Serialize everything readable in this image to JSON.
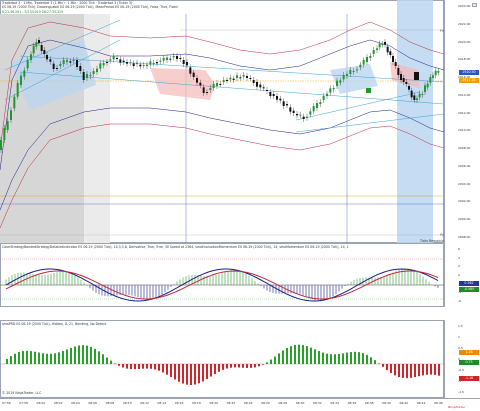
{
  "chart_window": {
    "header": "Traderbot 3 · 1 Min, Traderbot 3 (1 Min) · 1 Min · 2000 Tick · Traderbot 3 (Ticker 3)",
    "header_line2": "ES 06-19 (2000 Tick), DrawingLabel ES 06-19 (2000 Tick), MeanPeriod ES 06-19 (2000 Tick), False, True, Fixed",
    "info_line": "8,21,46,261 - 5/13/2019 08:27:35.329",
    "tags_top": "Prior High",
    "tags_bottom": "Prior Low",
    "ticks_remaining": "Ticks Remaining = 162"
  },
  "price_axis": {
    "labels": [
      "2924.00",
      "2922.00",
      "2920.00",
      "2918.00",
      "2916.00",
      "2914.00",
      "2912.00",
      "2910.00",
      "2908.00",
      "2906.00",
      "2904.00",
      "2902.00",
      "2900.00",
      "2898.00"
    ],
    "current_price": "2920.50",
    "current_price_color": "#2a58b8",
    "level_tag": "2917.25",
    "level_tag_color": "#f0a000"
  },
  "indicator1": {
    "header": "ColorStrategyBandedStrategyDetailedIndicator ES 06-19 (2000 Tick), 14,3,3,8, Derivative, True, True, 30 Speed at 2364, smaEvaluationMomentum ES 06-19 (2000 Tick), 14, smaMomentum ES 06-19 (2000 Tick), 14, 1",
    "labels": [
      "6",
      "4",
      "2",
      "0",
      "-2",
      "-4",
      "-6"
    ],
    "tag_blue": "0.562",
    "tag_green": "-0.565",
    "tag_blue_color": "#1d3a9a",
    "tag_green_color": "#1f8a2a"
  },
  "indicator2": {
    "header": "smaPRD ES 06-19 (2000 Tick), Hidden, 8, 21, Banding, No Detect",
    "labels": [
      "1.5",
      "1",
      "0.5",
      "0",
      "-0.5",
      "-1",
      "-1.5"
    ],
    "tag_orange": "1.26",
    "tag_green": "0.73",
    "tag_red": "-1.16",
    "tag_orange_color": "#f08a00",
    "tag_green_color": "#1f8a2a",
    "tag_red_color": "#d2232a"
  },
  "time_axis": {
    "labels": [
      "07:56",
      "07:58",
      "08:00",
      "08:02",
      "08:04",
      "08:06",
      "08:08",
      "08:10",
      "08:12",
      "08:14",
      "08:16",
      "08:18",
      "08:20",
      "08:22",
      "08:24",
      "08:26",
      "08:28",
      "08:30",
      "08:32",
      "08:34",
      "08:36",
      "08:38",
      "08:40",
      "08:42",
      "08:44",
      "08:46"
    ]
  },
  "footer": {
    "copyright": "© 2019 NinjaTrader, LLC",
    "watermark": "NinjaTrader"
  },
  "colors": {
    "candle_up": "#1c9a2a",
    "candle_down": "#111111",
    "band_blue": "#3aa0d8",
    "band_navy": "#1b1b8a",
    "band_red": "#c0283a",
    "zone_red": "#f4b8b8",
    "zone_blue": "#bcd6f0"
  }
}
